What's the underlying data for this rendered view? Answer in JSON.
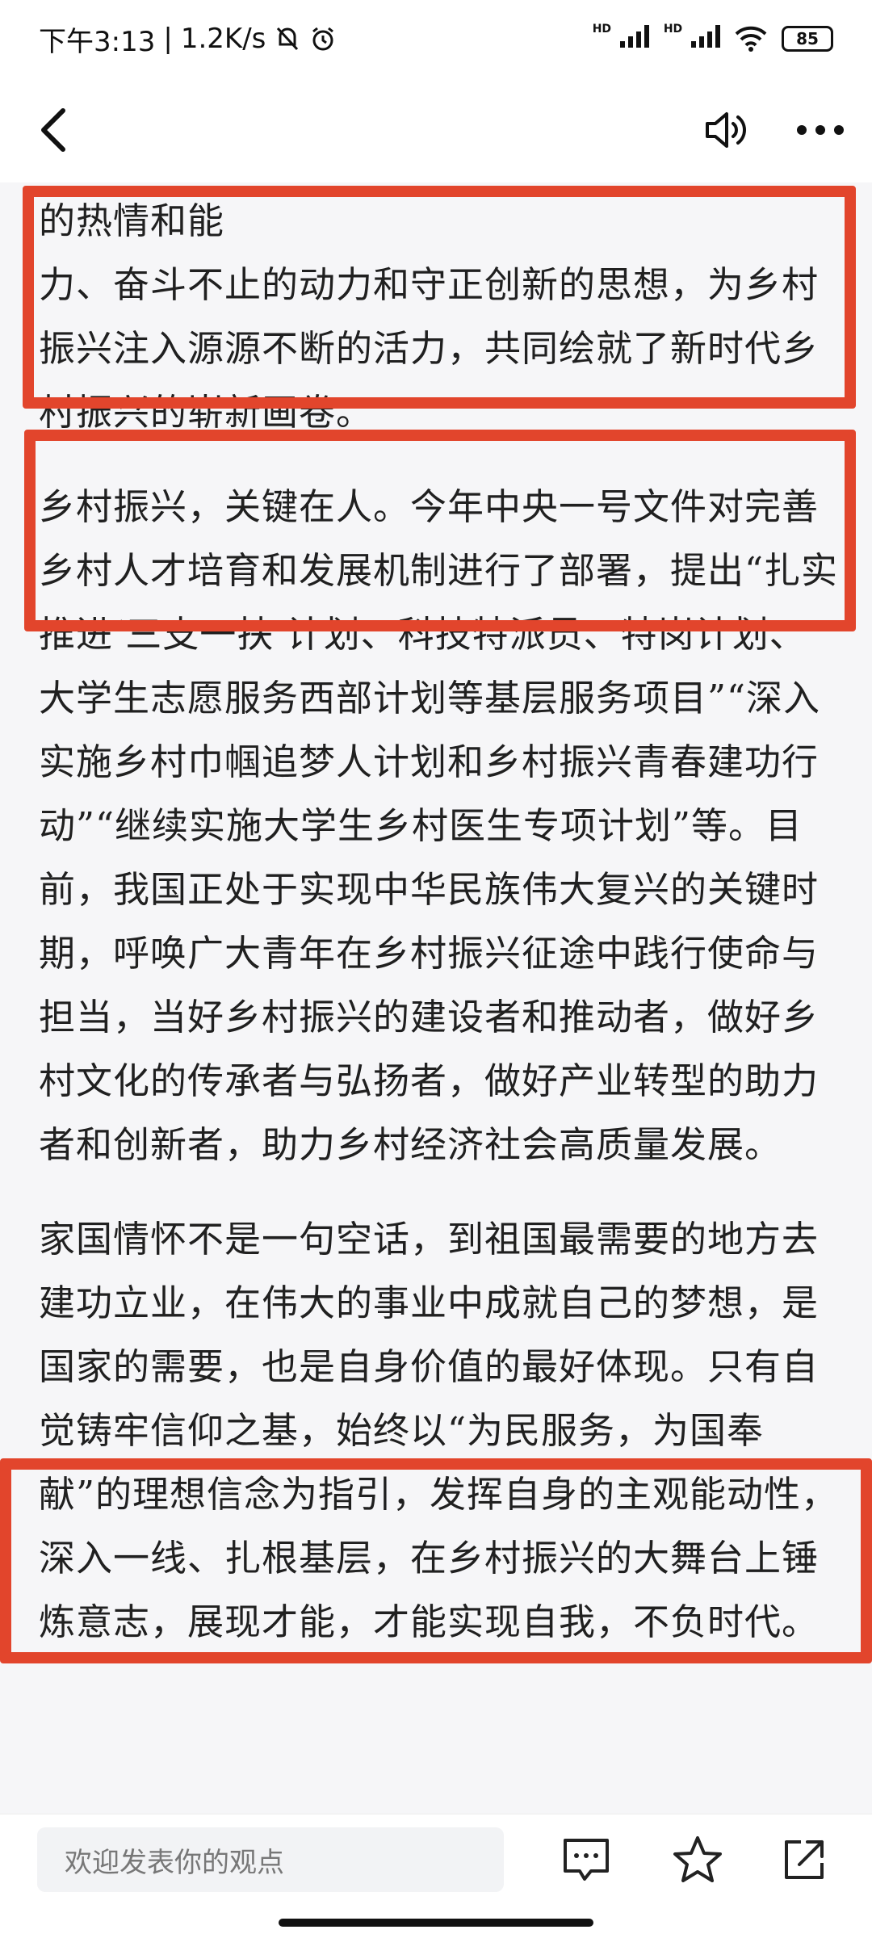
{
  "status_bar": {
    "time": "下午3:13",
    "separator": "|",
    "network_speed": "1.2K/s",
    "hd_label": "HD",
    "battery": "85"
  },
  "nav": {
    "back_icon": "back-arrow-icon",
    "speaker_icon": "speaker-icon",
    "more_icon": "more-dots-icon"
  },
  "article": {
    "partial_top_line": "推动形成了良好局面，激发了青年投身乡村振兴的热情和能",
    "paragraphs": [
      "力、奋斗不止的动力和守正创新的思想，为乡村振兴注入源源不断的活力，共同绘就了新时代乡村振兴的崭新画卷。",
      "乡村振兴，关键在人。今年中央一号文件对完善乡村人才培育和发展机制进行了部署，提出“扎实推进‘三支一扶’计划、科技特派员、特岗计划、大学生志愿服务西部计划等基层服务项目”“深入实施乡村巾帼追梦人计划和乡村振兴青春建功行动”“继续实施大学生乡村医生专项计划”等。目前，我国正处于实现中华民族伟大复兴的关键时期，呼唤广大青年在乡村振兴征途中践行使命与担当，当好乡村振兴的建设者和推动者，做好乡村文化的传承者与弘扬者，做好产业转型的助力者和创新者，助力乡村经济社会高质量发展。",
      "家国情怀不是一句空话，到祖国最需要的地方去建功立业，在伟大的事业中成就自己的梦想，是国家的需要，也是自身价值的最好体现。只有自觉铸牢信仰之基，始终以“为民服务，为国奉献”的理想信念为指引，发挥自身的主观能动性，深入一线、扎根基层，在乡村振兴的大舞台上锤炼意志，展现才能，才能实现自我，不负时代。"
    ]
  },
  "highlight_color": "#e2452c",
  "bottom_bar": {
    "comment_placeholder": "欢迎发表你的观点",
    "comment_icon": "comment-icon",
    "favorite_icon": "star-icon",
    "share_icon": "share-icon"
  }
}
